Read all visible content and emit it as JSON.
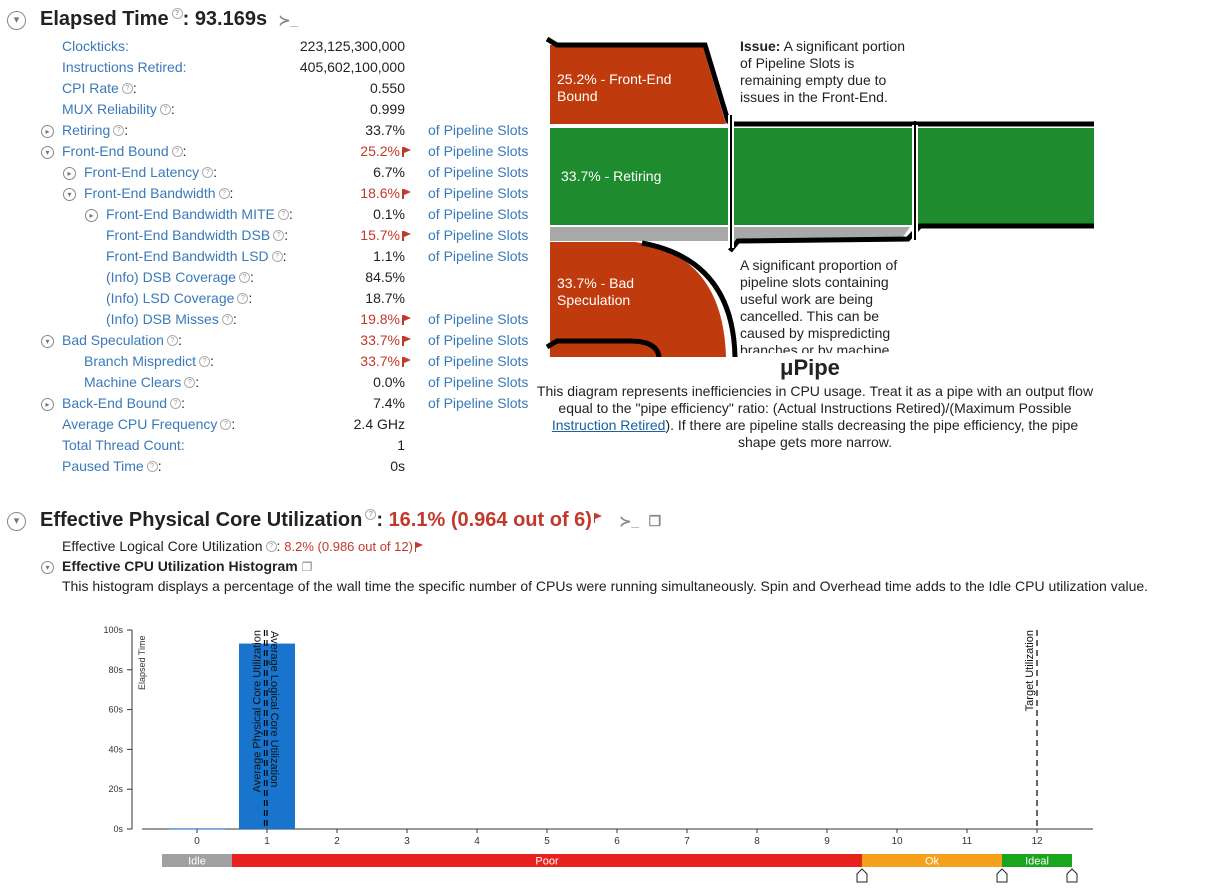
{
  "elapsed": {
    "title": "Elapsed Time",
    "sep": ":",
    "value": "93.169s",
    "metrics": [
      {
        "label": "Clockticks:",
        "value": "223,125,300,000",
        "unit": "",
        "indent": 0,
        "toggle": false,
        "help": false,
        "red": false
      },
      {
        "label": "Instructions Retired:",
        "value": "405,602,100,000",
        "unit": "",
        "indent": 0,
        "toggle": false,
        "help": false,
        "red": false
      },
      {
        "label": "CPI Rate",
        "value": "0.550",
        "unit": "",
        "indent": 0,
        "toggle": false,
        "help": true,
        "red": false
      },
      {
        "label": "MUX Reliability",
        "value": "0.999",
        "unit": "",
        "indent": 0,
        "toggle": false,
        "help": true,
        "red": false
      },
      {
        "label": "Retiring",
        "value": "33.7%",
        "unit": "of Pipeline Slots",
        "indent": 0,
        "toggle": "collapsed",
        "help": true,
        "red": false
      },
      {
        "label": "Front-End Bound",
        "value": "25.2%",
        "unit": "of Pipeline Slots",
        "indent": 0,
        "toggle": "expanded",
        "help": true,
        "red": true
      },
      {
        "label": "Front-End Latency",
        "value": "6.7%",
        "unit": "of Pipeline Slots",
        "indent": 1,
        "toggle": "collapsed",
        "help": true,
        "red": false
      },
      {
        "label": "Front-End Bandwidth",
        "value": "18.6%",
        "unit": "of Pipeline Slots",
        "indent": 1,
        "toggle": "expanded",
        "help": true,
        "red": true
      },
      {
        "label": "Front-End Bandwidth MITE",
        "value": "0.1%",
        "unit": "of Pipeline Slots",
        "indent": 2,
        "toggle": "collapsed",
        "help": true,
        "red": false
      },
      {
        "label": "Front-End Bandwidth DSB",
        "value": "15.7%",
        "unit": "of Pipeline Slots",
        "indent": 2,
        "toggle": false,
        "help": true,
        "red": true
      },
      {
        "label": "Front-End Bandwidth LSD",
        "value": "1.1%",
        "unit": "of Pipeline Slots",
        "indent": 2,
        "toggle": false,
        "help": true,
        "red": false
      },
      {
        "label": "(Info) DSB Coverage",
        "value": "84.5%",
        "unit": "",
        "indent": 2,
        "toggle": false,
        "help": true,
        "red": false
      },
      {
        "label": "(Info) LSD Coverage",
        "value": "18.7%",
        "unit": "",
        "indent": 2,
        "toggle": false,
        "help": true,
        "red": false
      },
      {
        "label": "(Info) DSB Misses",
        "value": "19.8%",
        "unit": "of Pipeline Slots",
        "indent": 2,
        "toggle": false,
        "help": true,
        "red": true
      },
      {
        "label": "Bad Speculation",
        "value": "33.7%",
        "unit": "of Pipeline Slots",
        "indent": 0,
        "toggle": "expanded",
        "help": true,
        "red": true
      },
      {
        "label": "Branch Mispredict",
        "value": "33.7%",
        "unit": "of Pipeline Slots",
        "indent": 1,
        "toggle": false,
        "help": true,
        "red": true
      },
      {
        "label": "Machine Clears",
        "value": "0.0%",
        "unit": "of Pipeline Slots",
        "indent": 1,
        "toggle": false,
        "help": true,
        "red": false
      },
      {
        "label": "Back-End Bound",
        "value": "7.4%",
        "unit": "of Pipeline Slots",
        "indent": 0,
        "toggle": "collapsed",
        "help": true,
        "red": false
      },
      {
        "label": "Average CPU Frequency",
        "value": "2.4 GHz",
        "unit": "",
        "indent": 0,
        "toggle": false,
        "help": true,
        "red": false
      },
      {
        "label": "Total Thread Count:",
        "value": "1",
        "unit": "",
        "indent": 0,
        "toggle": false,
        "help": false,
        "red": false
      },
      {
        "label": "Paused Time",
        "value": "0s",
        "unit": "",
        "indent": 0,
        "toggle": false,
        "help": true,
        "red": false
      }
    ]
  },
  "upipe": {
    "frontend_label": "25.2% - Front-End Bound",
    "retiring_label": "33.7% - Retiring",
    "badspec_label": "33.7% - Bad Speculation",
    "issue1_bold": "Issue:",
    "issue1_text": " A significant portion of Pipeline Slots is remaining empty due to issues in the Front-End.",
    "issue2_text": "A significant proportion of pipeline slots containing useful work are being cancelled. This can be caused by mispredicting branches or by machine",
    "title": "μPipe",
    "desc_part1": "This diagram represents inefficiencies in CPU usage. Treat it as a pipe with an output flow equal to the \"pipe efficiency\" ratio: (Actual Instructions Retired)/(Maximum Possible ",
    "desc_link": "Instruction Retired",
    "desc_part2": "). If there are pipeline stalls decreasing the pipe efficiency, the pipe shape gets more narrow.",
    "colors": {
      "red": "#bf3a0c",
      "green": "#1e8c2e",
      "gray": "#a8a8a8"
    }
  },
  "epcu": {
    "title": "Effective Physical Core Utilization",
    "sep": ":",
    "value": "16.1% (0.964 out of 6)",
    "logical_label": "Effective Logical Core Utilization",
    "logical_value": "8.2% (0.986 out of 12)",
    "hist_title": "Effective CPU Utilization Histogram",
    "hist_desc": "This histogram displays a percentage of the wall time the specific number of CPUs were running simultaneously. Spin and Overhead time adds to the Idle CPU utilization value."
  },
  "chart_data": {
    "type": "bar",
    "ylabel": "Elapsed Time",
    "categories": [
      "0",
      "1",
      "2",
      "3",
      "4",
      "5",
      "6",
      "7",
      "8",
      "9",
      "10",
      "11",
      "12"
    ],
    "values": [
      0.3,
      93.169,
      0,
      0,
      0,
      0,
      0,
      0,
      0,
      0,
      0,
      0,
      0
    ],
    "ylim": [
      0,
      100
    ],
    "yticks": [
      "0s",
      "20s",
      "40s",
      "60s",
      "80s",
      "100s"
    ],
    "markers": [
      {
        "label": "Average Physical Core Utilization",
        "x": 0.964
      },
      {
        "label": "Average Logical Core Utilization",
        "x": 0.986
      },
      {
        "label": "Target Utilization",
        "x": 12
      }
    ],
    "zones": [
      {
        "label": "Idle",
        "from": -0.5,
        "to": 0.5,
        "color": "#a0a0a0"
      },
      {
        "label": "Poor",
        "from": 0.5,
        "to": 9.5,
        "color": "#e8231f"
      },
      {
        "label": "Ok",
        "from": 9.5,
        "to": 11.5,
        "color": "#f5a11c"
      },
      {
        "label": "Ideal",
        "from": 11.5,
        "to": 12.5,
        "color": "#19a51d"
      }
    ],
    "bar_color": "#1874cd"
  }
}
